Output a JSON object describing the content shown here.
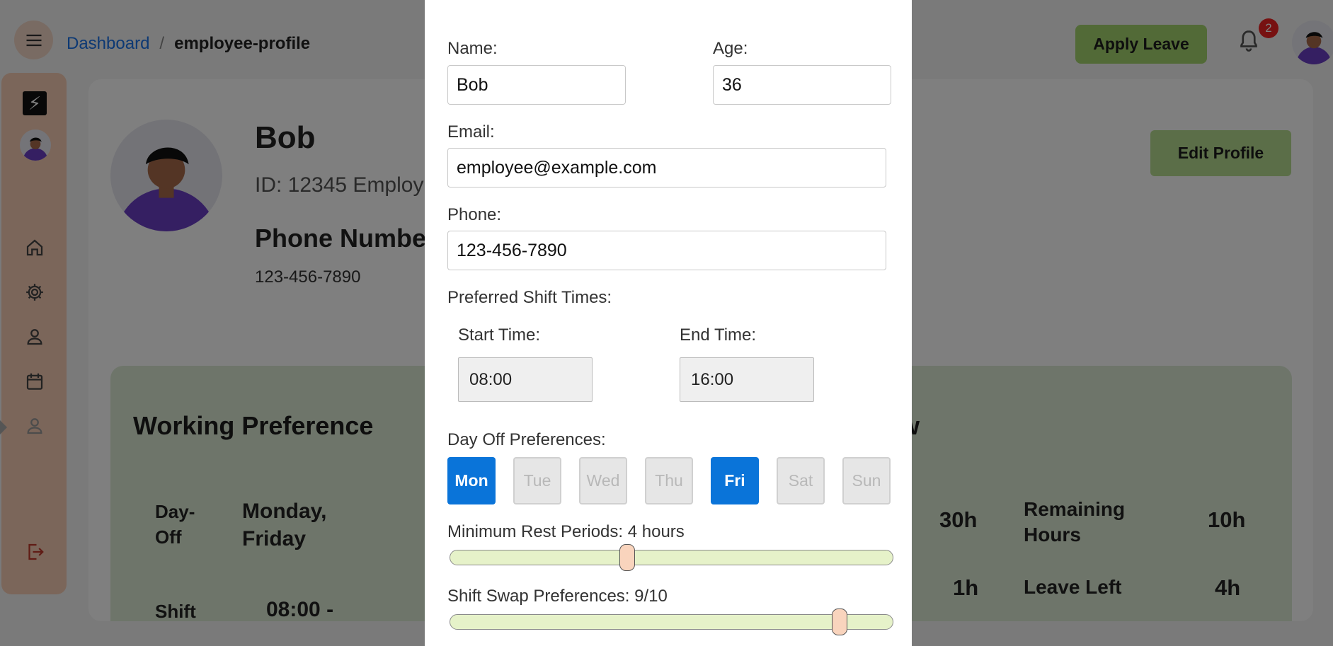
{
  "header": {
    "breadcrumb": [
      "Dashboard",
      "/",
      "employee-profile"
    ],
    "apply_leave_label": "Apply Leave",
    "notification_count": "2"
  },
  "sidebar": {
    "logo_glyph": "⚡",
    "icons": [
      "home-icon",
      "gear-icon",
      "person-icon",
      "calendar-icon",
      "person-outline-icon",
      "logout-icon"
    ]
  },
  "profile": {
    "name": "Bob",
    "id_line": "ID: 12345  Employ",
    "phone_label": "Phone Numbe",
    "phone": "123-456-7890",
    "edit_label": "Edit Profile"
  },
  "working_preference": {
    "title": "Working Preference",
    "dayoff_label": "Day-Off",
    "dayoff_value": "Monday, Friday",
    "shift_label": "Shift",
    "shift_value": "08:00 -"
  },
  "overview": {
    "title_tail": "ew",
    "val1": "30h",
    "remaining_label": "Remaining Hours",
    "val2": "10h",
    "val3": "1h",
    "leave_label": "Leave Left",
    "val4": "4h"
  },
  "modal": {
    "name_label": "Name:",
    "name_value": "Bob",
    "age_label": "Age:",
    "age_value": "36",
    "email_label": "Email:",
    "email_value": "employee@example.com",
    "phone_label": "Phone:",
    "phone_value": "123-456-7890",
    "shift_label": "Preferred Shift Times:",
    "start_label": "Start Time:",
    "start_value": "08:00",
    "end_label": "End Time:",
    "end_value": "16:00",
    "dayoff_label": "Day Off Preferences:",
    "days": [
      {
        "label": "Mon",
        "selected": true
      },
      {
        "label": "Tue",
        "selected": false
      },
      {
        "label": "Wed",
        "selected": false
      },
      {
        "label": "Thu",
        "selected": false
      },
      {
        "label": "Fri",
        "selected": true
      },
      {
        "label": "Sat",
        "selected": false
      },
      {
        "label": "Sun",
        "selected": false
      }
    ],
    "rest_label": "Minimum Rest Periods: 4 hours",
    "rest_fraction": 0.4,
    "swap_label": "Shift Swap Preferences: 9/10",
    "swap_fraction": 0.88
  },
  "colors": {
    "accent_blue": "#0a74d9",
    "apply_green": "#a4d46e",
    "sidebar_peach": "#f7cdb5",
    "panel_green": "#dcebd4"
  }
}
